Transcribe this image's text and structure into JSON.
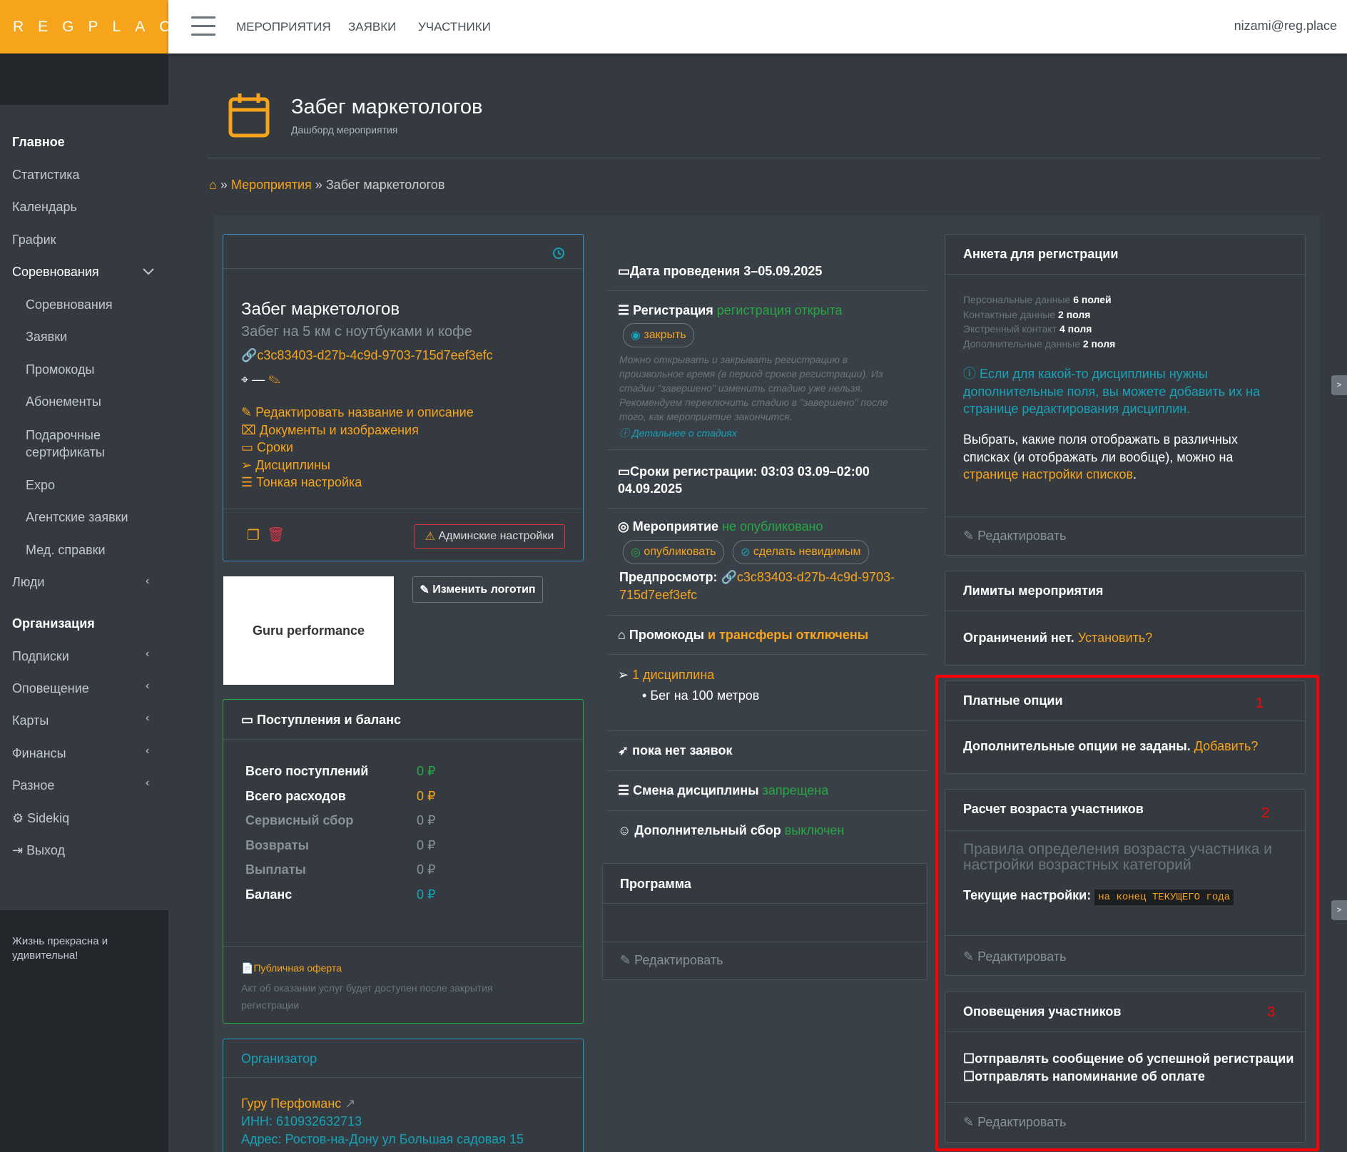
{
  "app": {
    "brand": "REGPLACE",
    "user_email": "nizami@reg.place"
  },
  "topnav": [
    "МЕРОПРИЯТИЯ",
    "ЗАЯВКИ",
    "УЧАСТНИКИ"
  ],
  "sidebar": {
    "items": [
      "Главное",
      "Статистика",
      "Календарь",
      "График",
      "Соревнования",
      "Соревнования",
      "Заявки",
      "Промокоды",
      "Абонементы",
      "Подарочные сертификаты",
      "Expo",
      "Агентские заявки",
      "Мед. справки",
      "Люди",
      "Организация",
      "Подписки",
      "Оповещение",
      "Карты",
      "Финансы",
      "Разное",
      "Sidekiq",
      "Выход"
    ],
    "footer": "Жизнь прекрасна и удивительна!"
  },
  "page": {
    "title": "Забег маркетологов",
    "subtitle": "Дашборд мероприятия"
  },
  "breadcrumb": {
    "sep": "»",
    "link": "Мероприятия",
    "sep2": "»",
    "current": "Забег маркетологов"
  },
  "event_card": {
    "name": "Забег маркетологов",
    "description": "Забег на 5 км с ноутбуками и кофе",
    "uuid": "c3c83403-d27b-4c9d-9703-715d7eef3efc",
    "location": "—",
    "links": [
      "Редактировать название и описание",
      "Документы и изображения",
      "Сроки",
      "Дисциплины",
      "Тонкая настройка"
    ],
    "admin_button": "Админские настройки"
  },
  "logo_block": {
    "logo_text": "Guru performance",
    "change_button": "Изменить логотип"
  },
  "finance": {
    "title": "Поступления и баланс",
    "rows": [
      {
        "label": "Всего поступлений",
        "value": "0 ₽"
      },
      {
        "label": "Всего расходов",
        "value": "0 ₽"
      },
      {
        "label": "Сервисный сбор",
        "value": "0 ₽"
      },
      {
        "label": "Возвраты",
        "value": "0 ₽"
      },
      {
        "label": "Выплаты",
        "value": "0 ₽"
      },
      {
        "label": "Баланс",
        "value": "0 ₽"
      }
    ],
    "offer": "Публичная оферта",
    "act_note": "Акт об оказании услуг будет доступен после закрытия регистрации"
  },
  "organizer": {
    "title": "Организатор",
    "name": "Гуру Перфоманс",
    "inn": "ИНН: 610932632713",
    "address": "Адрес: Ростов-на-Дону ул Большая садовая 15"
  },
  "middle": {
    "date": "Дата проведения 3–05.09.2025",
    "reg_label": "Регистрация",
    "reg_status": "регистрация открыта",
    "close_btn": "закрыть",
    "reg_help": "Можно открывать и закрывать регистрацию в произвольное время (в период сроков регистрации). Из стадии \"завершено\" изменить стадию уже нельзя. Рекомендуем переключить стадию в \"завершено\" после того, как мероприятие закончится.",
    "stages_link": "Детальнее о стадиях",
    "reg_period": "Сроки регистрации: 03:03 03.09–02:00 04.09.2025",
    "event_label": "Мероприятие",
    "event_status": "не опубликовано",
    "publish_btn": "опубликовать",
    "invisible_btn": "сделать невидимым",
    "preview_label": "Предпросмотр:",
    "preview_link": "c3c83403-d27b-4c9d-9703-715d7eef3efc",
    "promo_label": "Промокоды",
    "promo_status": "и трансферы отключены",
    "disciplines_link": "1 дисциплина",
    "discipline_item": "Бег на 100 метров",
    "no_apps": "пока нет заявок",
    "change_label": "Смена дисциплины",
    "change_status": "запрещена",
    "fee_label": "Дополнительный сбор",
    "fee_status": "выключен",
    "program_title": "Программа",
    "program_edit": "Редактировать"
  },
  "right": {
    "form_title": "Анкета для регистрации",
    "form_rows": [
      {
        "label": "Персональные данные",
        "value": "6 полей"
      },
      {
        "label": "Контактные данные",
        "value": "2 поля"
      },
      {
        "label": "Экстренный контакт",
        "value": "4 поля"
      },
      {
        "label": "Дополнительные данные",
        "value": "2 поля"
      }
    ],
    "form_info": "Если для какой-то дисциплины нужны дополнительные поля, вы можете добавить их на странице редактирования дисциплин.",
    "form_lists_a": "Выбрать, какие поля отображать в различных списках (и отображать ли вообще), можно на ",
    "form_lists_link": "странице настройки списков",
    "form_lists_b": ".",
    "edit": "Редактировать",
    "limits_title": "Лимиты мероприятия",
    "limits_text": "Ограничений нет.",
    "limits_link": "Установить?",
    "paid_title": "Платные опции",
    "paid_text": "Дополнительные опции не заданы.",
    "paid_link": "Добавить?",
    "age_title": "Расчет возраста участников",
    "age_desc": "Правила определения возраста участника и настройки возрастных категорий",
    "age_current": "Текущие настройки:",
    "age_badge": "на конец ТЕКУЩЕГО года",
    "notif_title": "Оповещения участников",
    "notif_options": [
      "отправлять сообщение об успешной регистрации",
      "отправлять напоминание об оплате"
    ],
    "markers": [
      "1",
      "2",
      "3"
    ]
  },
  "colors": {
    "accent": "#f7a41d",
    "bg": "#343a40",
    "sidebar_dark": "#23272b",
    "green": "#28a745",
    "cyan": "#17a2b8",
    "highlight": "#ff0000"
  }
}
